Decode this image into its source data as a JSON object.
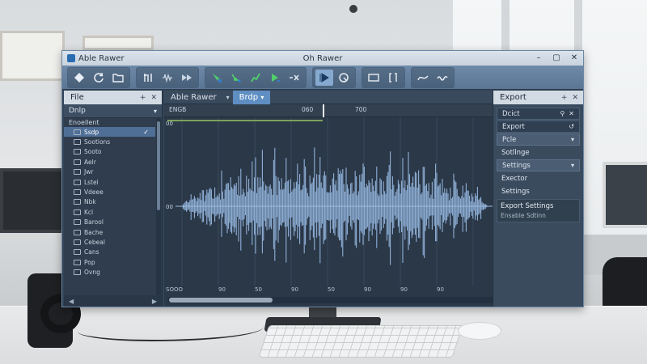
{
  "window": {
    "app_name": "Able Rawer",
    "title": "Oh Rawer",
    "controls": [
      "–",
      "▢",
      "✕"
    ]
  },
  "toolbar": {
    "groups": [
      [
        "diamond-icon",
        "refresh-icon",
        "folder-icon"
      ],
      [
        "cut-icon",
        "waveform-icon",
        "play-forward-icon"
      ],
      [
        "select-icon",
        "node-icon",
        "draw-icon",
        "play-icon",
        "scissors-icon"
      ],
      [
        "play-active-icon",
        "loop-icon"
      ],
      [
        "rect-icon",
        "bracket-icon"
      ],
      [
        "curve-icon",
        "wave-small-icon"
      ]
    ]
  },
  "left_panel": {
    "title": "File",
    "actions": [
      "+",
      "✕"
    ],
    "sub_label": "Dnlp",
    "root_label": "Enoellent",
    "items": [
      {
        "label": "Ssdp",
        "selected": true
      },
      {
        "label": "Sootions"
      },
      {
        "label": "Sooto"
      },
      {
        "label": "Aelr"
      },
      {
        "label": "Jwr"
      },
      {
        "label": "Lstel"
      },
      {
        "label": "Vdeee"
      },
      {
        "label": "Nbk"
      },
      {
        "label": "Kcl"
      },
      {
        "label": "Barool"
      },
      {
        "label": "Bache"
      },
      {
        "label": "Cebeal"
      },
      {
        "label": "Cans"
      },
      {
        "label": "Pop"
      },
      {
        "label": "Ovng"
      }
    ],
    "footer": [
      "◀",
      "▶"
    ]
  },
  "editor": {
    "tabs": [
      {
        "label": "Able Rawer",
        "selected": false
      },
      {
        "label": "Brdp",
        "selected": true
      }
    ],
    "tab_actions": [
      "↺",
      "✕"
    ],
    "ruler_labels": [
      "ENGB",
      "060",
      "700"
    ],
    "bottom_labels": [
      "SOOO",
      "90",
      "50",
      "90",
      "50",
      "90",
      "90",
      "90"
    ],
    "left_markers": [
      "00",
      "00"
    ]
  },
  "right_panel": {
    "title": "Export",
    "actions": [
      "+",
      "✕"
    ],
    "field_label": "Dcict",
    "rows": [
      {
        "label": "Export",
        "type": "field"
      },
      {
        "label": "Pcle",
        "type": "bar"
      },
      {
        "label": "Sotllnge",
        "type": "plain"
      },
      {
        "label": "Settings",
        "type": "bar"
      },
      {
        "label": "Exector",
        "type": "plain"
      },
      {
        "label": "Settings",
        "type": "plain"
      }
    ],
    "block": {
      "title": "Export Settings",
      "subtitle": "Ensable Sdtinn"
    }
  },
  "colors": {
    "accent": "#5f8ec2",
    "waveform": "#8fb1d8",
    "toolbar_green": "#4fd16a",
    "toolbar_blue": "#2f7fd6"
  }
}
